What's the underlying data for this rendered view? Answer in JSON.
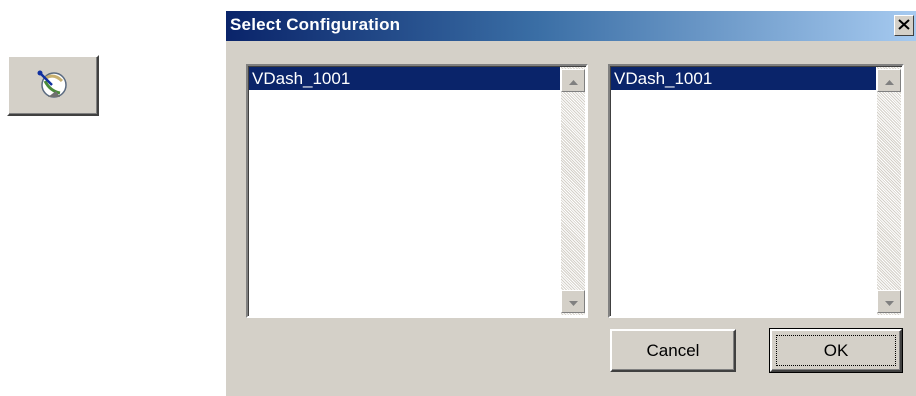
{
  "launcher": {
    "icon": "satellite-dish-icon"
  },
  "dialog": {
    "title": "Select Configuration",
    "close_icon": "close-icon",
    "left_list": {
      "items": [
        {
          "label": "VDash_1001",
          "selected": true
        }
      ]
    },
    "right_list": {
      "items": [
        {
          "label": "VDash_1001",
          "selected": true
        }
      ]
    },
    "buttons": {
      "cancel_label": "Cancel",
      "ok_label": "OK"
    }
  },
  "colors": {
    "window_face": "#d4d0c8",
    "title_start": "#0a246a",
    "title_end": "#a6caf0",
    "selection": "#0a246a"
  }
}
